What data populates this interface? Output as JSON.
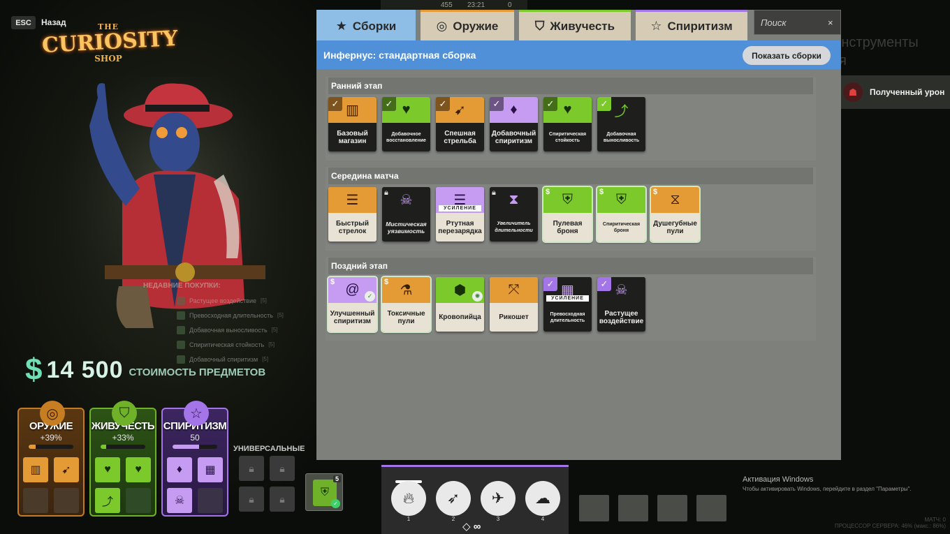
{
  "nav": {
    "esc": "ESC",
    "back": "Назад"
  },
  "logo": {
    "the": "THE",
    "curiosity": "CURIOSITY",
    "shop": "SHOP"
  },
  "topbar": {
    "souls": "455",
    "time": "23:21",
    "kills": "0"
  },
  "recent": {
    "title": "НЕДАВНИЕ ПОКУПКИ:",
    "items": [
      {
        "name": "Растущее воздействие",
        "key": "[5]"
      },
      {
        "name": "Превосходная длительность",
        "key": "[5]"
      },
      {
        "name": "Добавочная выносливость",
        "key": "[5]"
      },
      {
        "name": "Спиритическая стойкость",
        "key": "[5]"
      },
      {
        "name": "Добавочный спиритизм",
        "key": "[5]"
      }
    ]
  },
  "cost": {
    "symbol": "$",
    "amount": "14 500",
    "label": "СТОИМОСТЬ ПРЕДМЕТОВ"
  },
  "categories": {
    "weapon": {
      "name": "ОРУЖИЕ",
      "value": "+39%",
      "fill": 0.15
    },
    "vitality": {
      "name": "ЖИВУЧЕСТЬ",
      "value": "+33%",
      "fill": 0.12
    },
    "spirit": {
      "name": "СПИРИТИЗМ",
      "value": "50",
      "fill": 0.6
    }
  },
  "universal_label": "УНИВЕРСАЛЬНЫЕ",
  "flex_item": {
    "badge": "5"
  },
  "abilities": {
    "nums": [
      "1",
      "2",
      "3",
      "4"
    ],
    "footer": "◇ ∞"
  },
  "tabs": {
    "builds": "Сборки",
    "weapon": "Оружие",
    "vitality": "Живучесть",
    "spirit": "Спиритизм"
  },
  "search": {
    "placeholder": "Поиск",
    "clear": "×"
  },
  "header": {
    "title": "Инфернус: стандартная сборка",
    "button": "Показать сборки"
  },
  "sections": {
    "early": {
      "title": "Ранний этап",
      "items": [
        "Базовый магазин",
        "Добавочное восстановление",
        "Спешная стрельба",
        "Добавочный спиритизм",
        "Спиритическая стойкость",
        "Добавочная выносливость"
      ]
    },
    "mid": {
      "title": "Середина матча",
      "items": [
        "Быстрый стрелок",
        "Мистическая уязвимость",
        "Ртутная перезарядка",
        "Увеличитель длительности",
        "Пулевая броня",
        "Спиритическая броня",
        "Душегубные пули"
      ]
    },
    "late": {
      "title": "Поздний этап",
      "items": [
        "Улучшенный спиритизм",
        "Токсичные пули",
        "Кровопийца",
        "Рикошет",
        "Превосходная длительность",
        "Растущее воздействие"
      ]
    }
  },
  "boost_label": "УСИЛЕНИЕ",
  "ghost": {
    "line1": "Инструменты",
    "line2": "ия"
  },
  "damage": {
    "label": "Полученный урон"
  },
  "windows": {
    "title": "Активация Windows",
    "sub": "Чтобы активировать Windows, перейдите в раздел \"Параметры\"."
  },
  "server": {
    "line1": "МАТЧ: 0",
    "line2": "ПРОЦЕССОР СЕРВЕРА: 46% (макс.: 86%)"
  },
  "colors": {
    "weapon": "#e49a35",
    "vitality": "#7bc92b",
    "spirit": "#c59cf2",
    "header": "#4f90d8",
    "tab_active": "#8ebee6"
  }
}
